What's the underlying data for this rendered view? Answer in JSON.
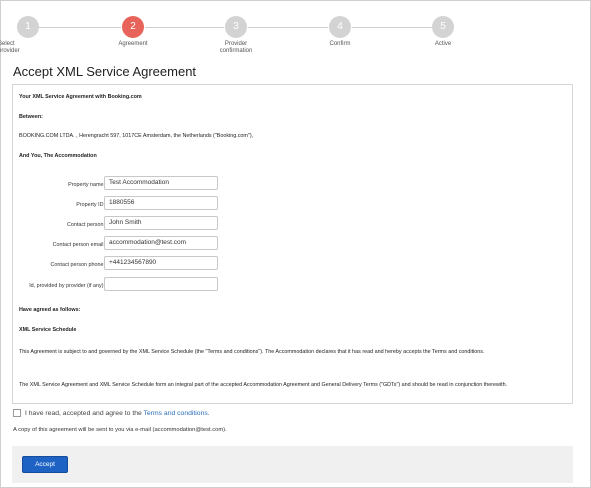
{
  "stepper": {
    "steps": [
      {
        "number": "1",
        "label": "Select provider",
        "state": "done"
      },
      {
        "number": "2",
        "label": "Agreement",
        "state": "active"
      },
      {
        "number": "3",
        "label": "Provider confirmation",
        "state": "todo"
      },
      {
        "number": "4",
        "label": "Confirm",
        "state": "todo"
      },
      {
        "number": "5",
        "label": "Active",
        "state": "todo"
      }
    ],
    "active_color": "#e8645a",
    "inactive_color": "#d3d3d3"
  },
  "page_title": "Accept XML Service Agreement",
  "agreement": {
    "heading": "Your XML Service Agreement with Booking.com",
    "between_label": "Between:",
    "party_booking": "BOOKING.COM LTDA. , Herengracht 597, 1017CE Amsterdam, the Netherlands (\"Booking.com\"),",
    "and_you": "And You, The Accommodation",
    "fields": [
      {
        "label": "Property name:",
        "value": "Test Accommodation"
      },
      {
        "label": "Property ID:",
        "value": "1880556"
      },
      {
        "label": "Contact person:",
        "value": "John Smith"
      },
      {
        "label": "Contact person email:",
        "value": "accommodation@test.com"
      },
      {
        "label": "Contact person phone:",
        "value": "+441234567890"
      },
      {
        "label": "Id, provided by provider (if any):",
        "value": ""
      }
    ],
    "agreed_label": "Have agreed as follows:",
    "schedule_heading": "XML Service Schedule",
    "paragraph_1": "This Agreement is subject to and governed by the XML Service Schedule (the \"Terms and conditions\"). The Accommodation declares that it has read and hereby accepts the Terms and conditions.",
    "paragraph_2": "The XML Service Agreement and XML Service Schedule form an integral part of the accepted Accommodation Agreement and General Delivery Terms (\"GDTs\") and should be read in conjunction therewith."
  },
  "agree": {
    "text": "I have read, accepted and agree to the",
    "link": "Terms and conditions",
    "suffix": ".",
    "checked": false
  },
  "copy_note": "A copy of this agreement will be sent to you via e-mail (accommodation@test.com).",
  "footer": {
    "accept_label": "Accept",
    "accent": "#1e63c4"
  }
}
